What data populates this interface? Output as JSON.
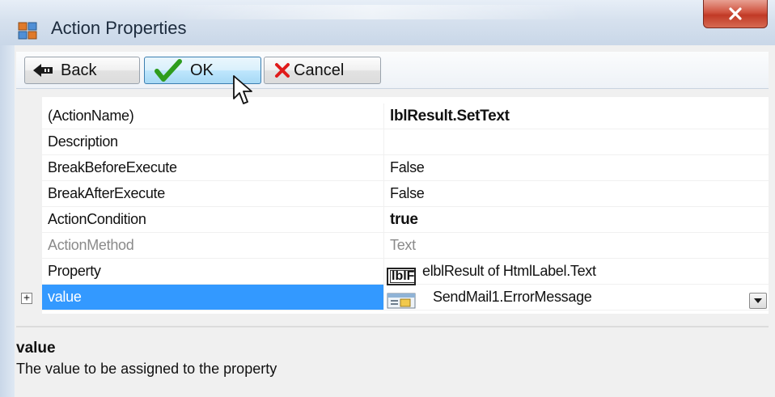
{
  "window": {
    "title": "Action Properties",
    "icons": {
      "app": "app-window-icon",
      "close": "close-icon"
    }
  },
  "toolbar": {
    "back_label": "Back",
    "ok_label": "OK",
    "cancel_label": "Cancel",
    "icons": {
      "back": "back-arrow-icon",
      "ok": "green-checkmark-icon",
      "cancel": "red-x-icon"
    }
  },
  "properties": [
    {
      "name": "(ActionName)",
      "value": "lblResult.SetText",
      "bold": true
    },
    {
      "name": "Description",
      "value": ""
    },
    {
      "name": "BreakBeforeExecute",
      "value": "False"
    },
    {
      "name": "BreakAfterExecute",
      "value": "False"
    },
    {
      "name": "ActionCondition",
      "value": "true",
      "bold": true
    },
    {
      "name": "ActionMethod",
      "value": "Text",
      "disabled": true
    },
    {
      "name": "Property",
      "value": "elblResult of HtmlLabel.Text",
      "icon_text": "lblF"
    },
    {
      "name": "value",
      "value": "SendMail1.ErrorMessage",
      "selected": true,
      "expandable": true
    }
  ],
  "help": {
    "title": "value",
    "description": "The value to be assigned to the property"
  },
  "colors": {
    "selection": "#3399ff",
    "close_button": "#c13a26",
    "checkmark": "#2e9c1e",
    "cancel_x": "#e01b1b"
  }
}
